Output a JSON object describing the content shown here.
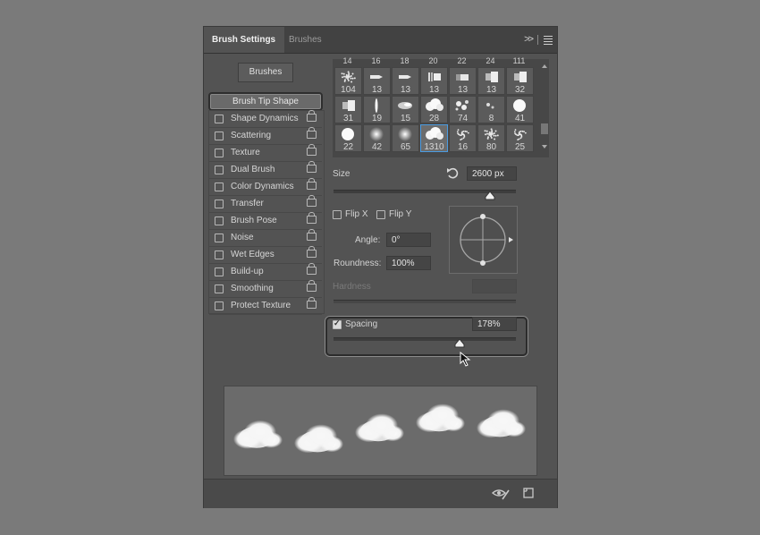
{
  "tabs": {
    "active": "Brush Settings",
    "inactive": "Brushes"
  },
  "brushes_button": "Brushes",
  "tip_shape_label": "Brush Tip Shape",
  "options": [
    {
      "label": "Shape Dynamics",
      "checked": false
    },
    {
      "label": "Scattering",
      "checked": false
    },
    {
      "label": "Texture",
      "checked": false
    },
    {
      "label": "Dual Brush",
      "checked": false
    },
    {
      "label": "Color Dynamics",
      "checked": false
    },
    {
      "label": "Transfer",
      "checked": false
    },
    {
      "label": "Brush Pose",
      "checked": false
    },
    {
      "label": "Noise",
      "checked": false
    },
    {
      "label": "Wet Edges",
      "checked": false
    },
    {
      "label": "Build-up",
      "checked": false
    },
    {
      "label": "Smoothing",
      "checked": false
    },
    {
      "label": "Protect Texture",
      "checked": false
    }
  ],
  "brush_grid": {
    "partial_top": [
      "14",
      "16",
      "18",
      "20",
      "22",
      "24",
      "111"
    ],
    "rows": [
      [
        {
          "size": "104",
          "kind": "texture"
        },
        {
          "size": "13",
          "kind": "marker"
        },
        {
          "size": "13",
          "kind": "marker"
        },
        {
          "size": "13",
          "kind": "bristle"
        },
        {
          "size": "13",
          "kind": "flat"
        },
        {
          "size": "13",
          "kind": "airbrush"
        },
        {
          "size": "32",
          "kind": "airbrush"
        }
      ],
      [
        {
          "size": "31",
          "kind": "airbrush"
        },
        {
          "size": "19",
          "kind": "line"
        },
        {
          "size": "15",
          "kind": "smudge"
        },
        {
          "size": "28",
          "kind": "cloud"
        },
        {
          "size": "74",
          "kind": "splatter"
        },
        {
          "size": "8",
          "kind": "small"
        },
        {
          "size": "41",
          "kind": "round-hard"
        }
      ],
      [
        {
          "size": "22",
          "kind": "round-hard"
        },
        {
          "size": "42",
          "kind": "round-soft"
        },
        {
          "size": "65",
          "kind": "round-soft"
        },
        {
          "size": "1310",
          "kind": "cloud",
          "selected": true
        },
        {
          "size": "16",
          "kind": "spray"
        },
        {
          "size": "80",
          "kind": "texture"
        },
        {
          "size": "25",
          "kind": "spray"
        }
      ]
    ]
  },
  "size": {
    "label": "Size",
    "value": "2600 px",
    "slider_percent": 0.86
  },
  "flip_x": {
    "label": "Flip X",
    "checked": false
  },
  "flip_y": {
    "label": "Flip Y",
    "checked": false
  },
  "angle": {
    "label": "Angle:",
    "value": "0°"
  },
  "roundness": {
    "label": "Roundness:",
    "value": "100%"
  },
  "hardness": {
    "label": "Hardness",
    "value": ""
  },
  "spacing": {
    "label": "Spacing",
    "checked": true,
    "value": "178%",
    "slider_percent": 0.69
  },
  "preview_clouds": 5,
  "icons": {
    "reset": "reset-icon",
    "preview_toggle": "eye-brush-icon",
    "new_preset": "new-preset-icon",
    "expand": "double-chevron-icon",
    "menu": "hamburger-icon"
  }
}
